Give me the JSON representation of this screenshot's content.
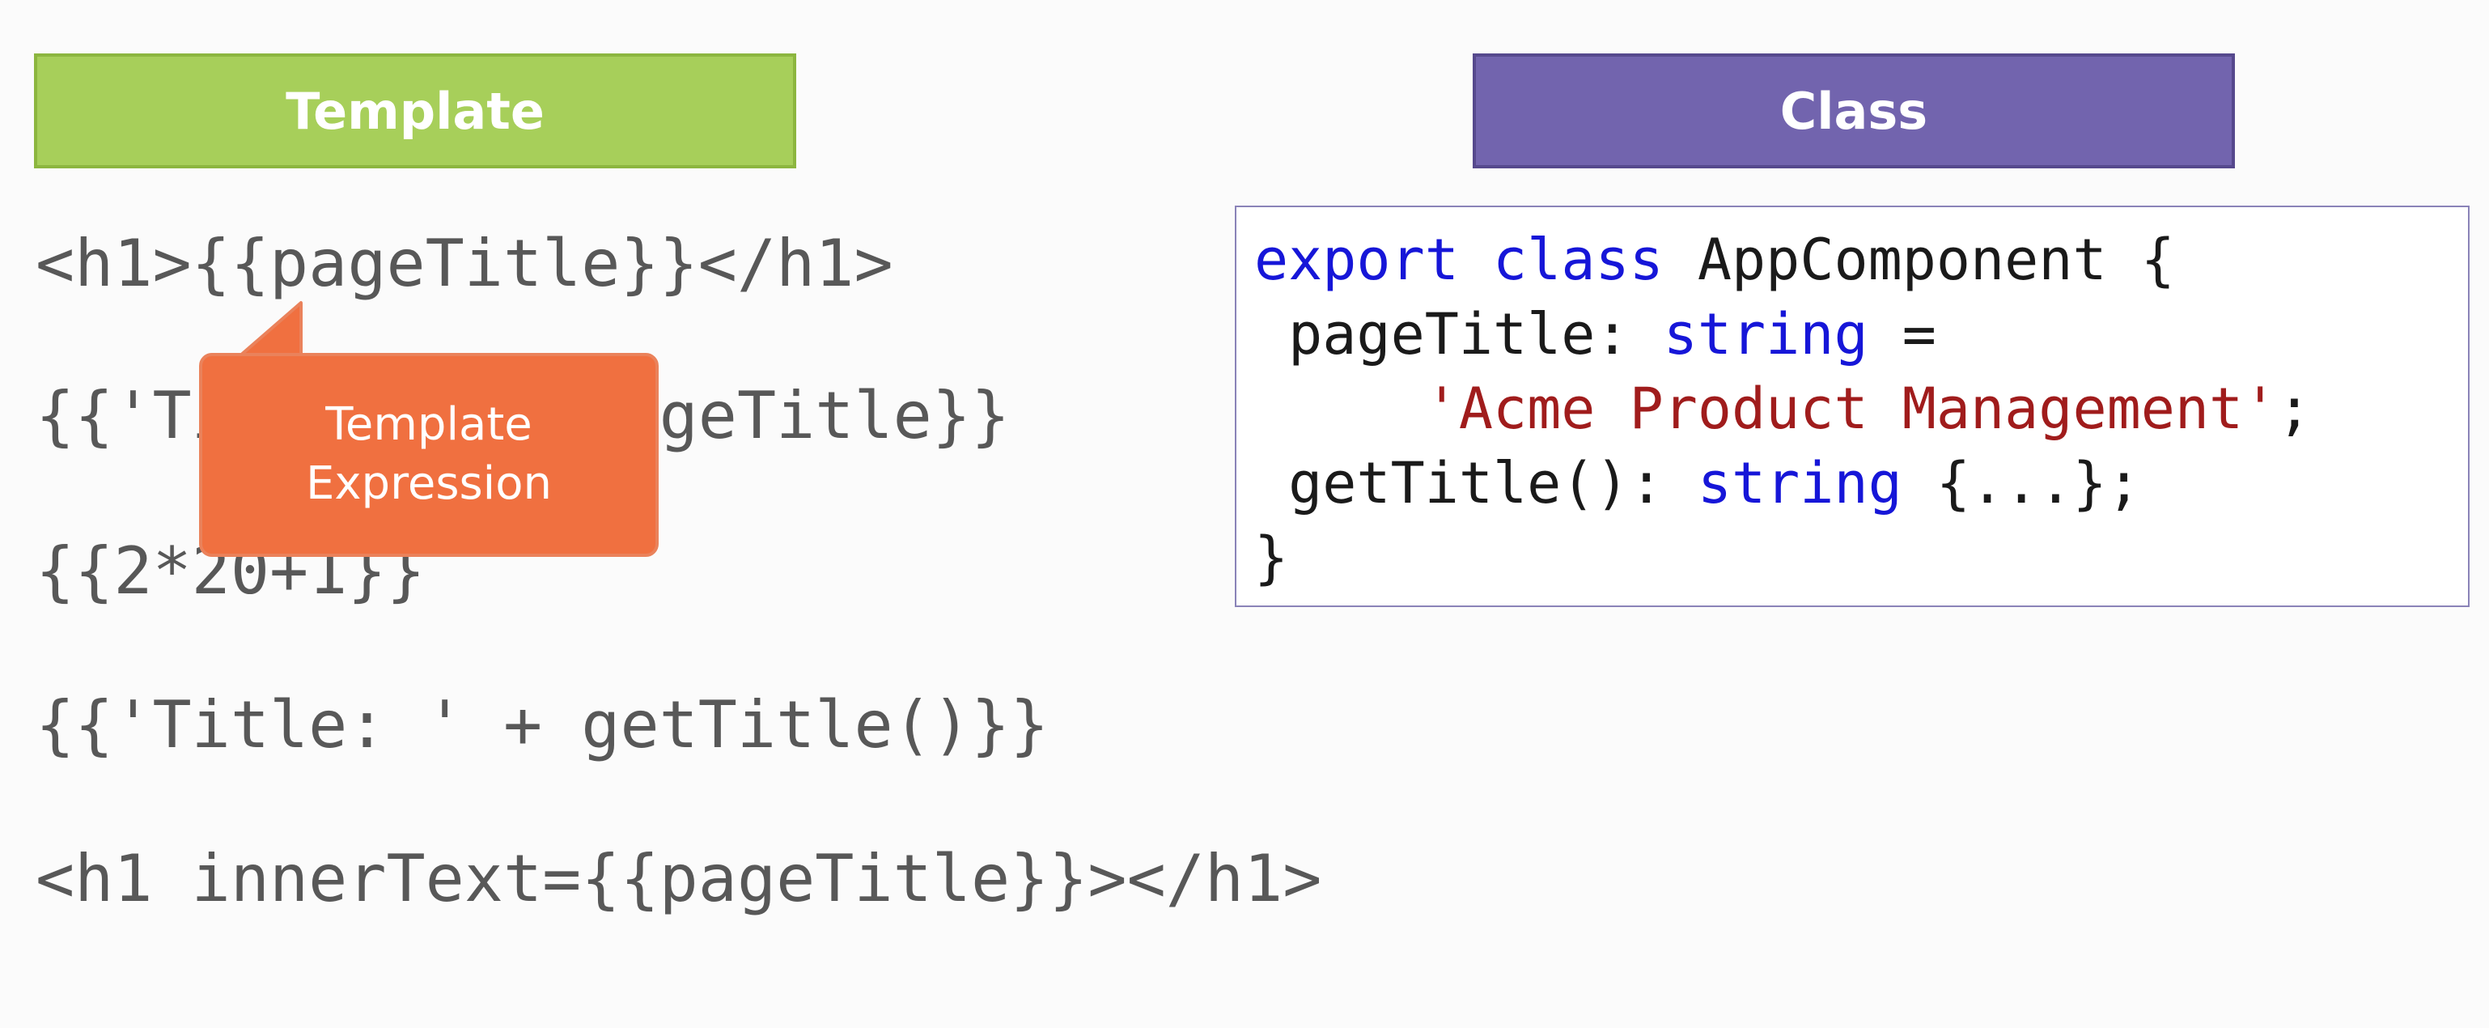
{
  "headers": {
    "template": "Template",
    "class": "Class"
  },
  "template_lines": [
    "<h1>{{pageTitle}}</h1>",
    "{{'Title: ' + pageTitle}}",
    "{{2*20+1}}",
    "{{'Title: ' + getTitle()}}",
    "<h1 innerText={{pageTitle}}></h1>"
  ],
  "callout": {
    "line1": "Template",
    "line2": "Expression"
  },
  "class_code": {
    "line1": {
      "kw1": "export",
      "sp1": " ",
      "kw2": "class",
      "rest": " AppComponent {"
    },
    "line2": {
      "prop": " pageTitle: ",
      "type": "string",
      "eq": " ="
    },
    "line3": {
      "indent": "     ",
      "str": "'Acme Product Management'",
      "semi": ";"
    },
    "line4": {
      "method": " getTitle(): ",
      "type": "string",
      "body": " {...};"
    },
    "line5": "}"
  },
  "colors": {
    "template_header": "#a7cf5a",
    "class_header": "#7264ae",
    "callout": "#f07040",
    "keyword": "#1616d8",
    "string": "#a01c1c",
    "code_text": "#585858"
  }
}
